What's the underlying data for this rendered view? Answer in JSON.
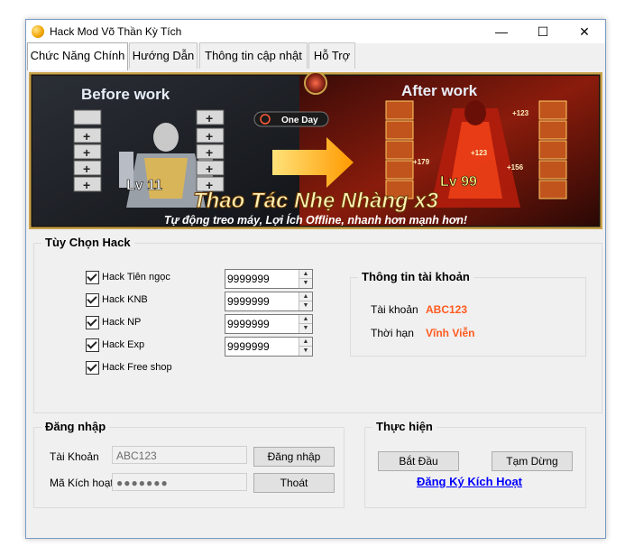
{
  "window": {
    "title": "Hack Mod Võ Thần Kỳ Tích",
    "minimize": "—",
    "maximize": "☐",
    "close": "✕"
  },
  "tabs": [
    {
      "label": "Chức Năng Chính"
    },
    {
      "label": "Hướng Dẫn"
    },
    {
      "label": "Thông tin cập nhật"
    },
    {
      "label": "Hỗ Trợ"
    }
  ],
  "banner": {
    "before": "Before work",
    "after": "After work",
    "badge": "One Day",
    "lv_before": "Lv 11",
    "lv_after": "Lv 99",
    "headline": "Thao Tác Nhẹ Nhàng x3",
    "tagline": "Tự động treo máy, Lợi Ích Offline, nhanh hơn mạnh hơn!",
    "plus": "+",
    "stats": [
      "+123",
      "+179",
      "+123",
      "+156"
    ]
  },
  "hack_options": {
    "title": "Tùy Chọn Hack",
    "items": [
      {
        "label": "Hack Tiên ngọc",
        "checked": true,
        "value": "9999999"
      },
      {
        "label": "Hack KNB",
        "checked": true,
        "value": "9999999"
      },
      {
        "label": "Hack NP",
        "checked": true,
        "value": "9999999"
      },
      {
        "label": "Hack Exp",
        "checked": true,
        "value": "9999999"
      },
      {
        "label": "Hack Free shop",
        "checked": true
      }
    ]
  },
  "account_info": {
    "title": "Thông tin tài khoản",
    "account_label": "Tài khoản",
    "account_value": "ABC123",
    "term_label": "Thời hạn",
    "term_value": "Vĩnh Viễn"
  },
  "login": {
    "title": "Đăng nhập",
    "account_label": "Tài Khoản",
    "account_value": "ABC123",
    "code_label": "Mã Kích hoạt",
    "code_value": "●●●●●●●",
    "login_button": "Đăng nhập",
    "exit_button": "Thoát"
  },
  "execute": {
    "title": "Thực hiện",
    "start_button": "Bắt Đầu",
    "pause_button": "Tạm Dừng",
    "register_link": "Đăng Ký Kích Hoạt"
  },
  "colors": {
    "accent_value": "#ff5a1f",
    "link": "#0000ff"
  }
}
